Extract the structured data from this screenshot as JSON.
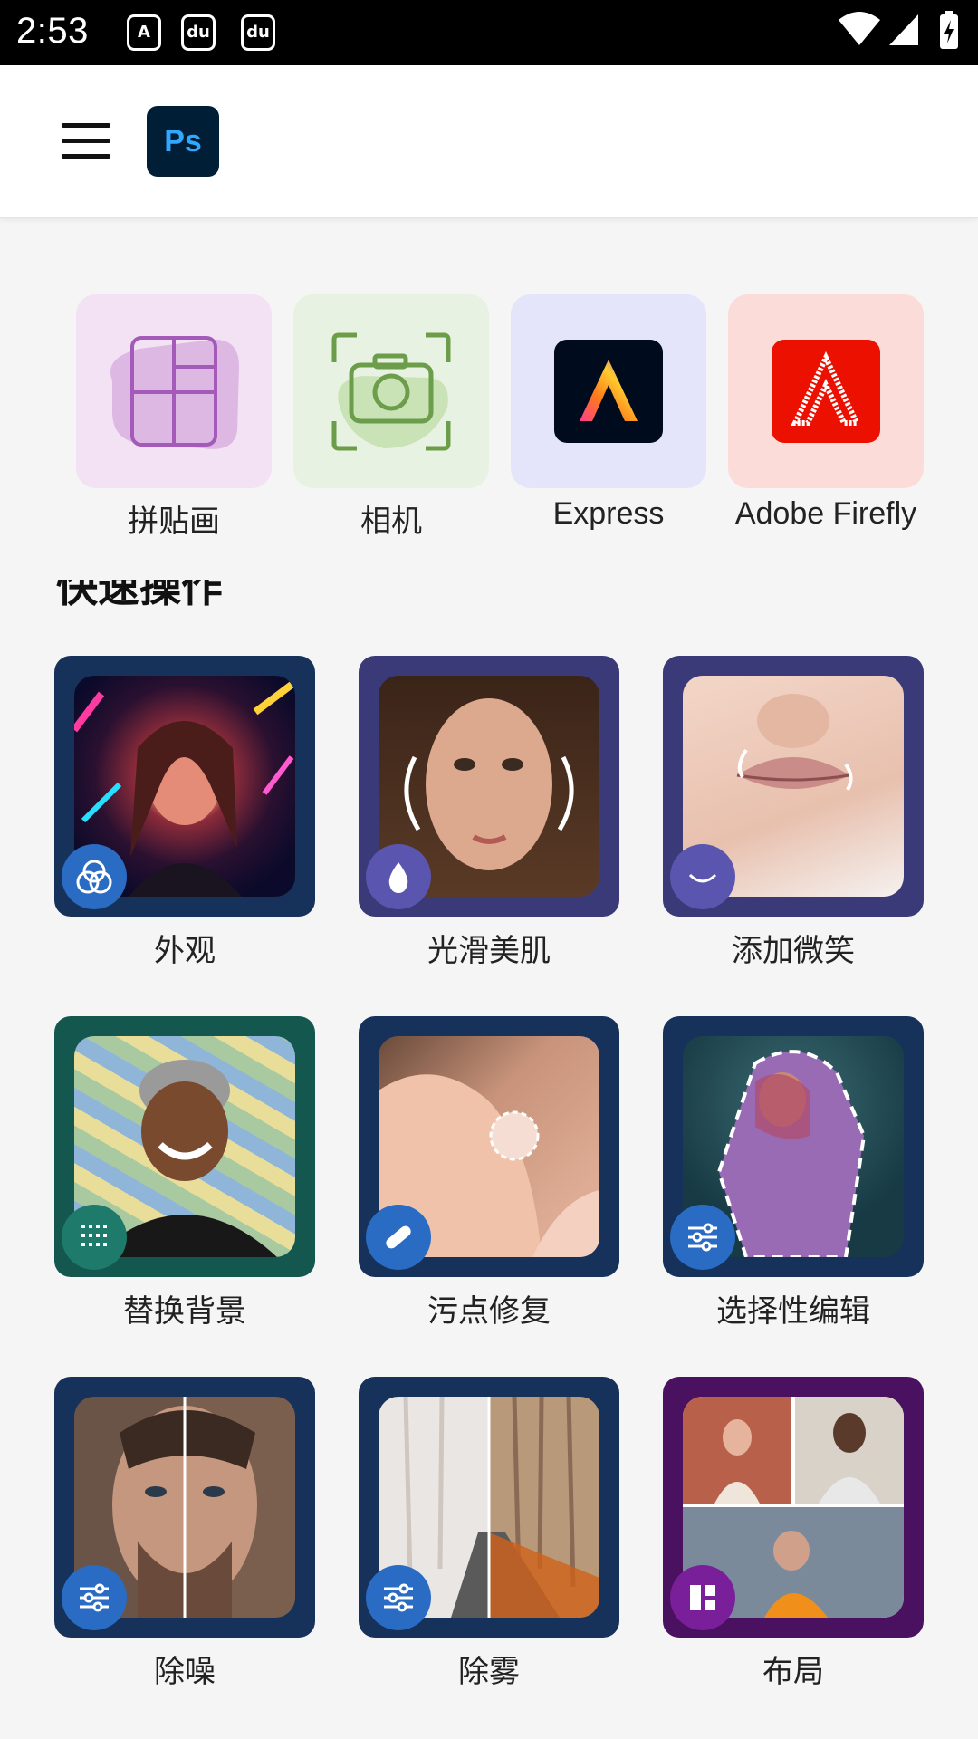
{
  "status_bar": {
    "time": "2:53",
    "notif_icons": [
      "a-icon",
      "baidu-icon",
      "baidu-icon"
    ],
    "right_icons": [
      "wifi-icon",
      "signal-icon",
      "battery-icon"
    ]
  },
  "app_bar": {
    "menu_icon": "hamburger-icon",
    "logo_text": "Ps"
  },
  "shortcuts": [
    {
      "label": "拼贴画",
      "icon": "collage-icon",
      "bg": "#f3e2f4"
    },
    {
      "label": "相机",
      "icon": "camera-icon",
      "bg": "#e8f2e2"
    },
    {
      "label": "Express",
      "icon": "adobe-express-icon",
      "bg": "#e4e4fb"
    },
    {
      "label": "Adobe Firefly",
      "icon": "adobe-firefly-icon",
      "bg": "#fcdcd8"
    }
  ],
  "section_title": "快速操作",
  "quick_actions": [
    {
      "label": "外观",
      "badge_icon": "looks-icon",
      "frame": "#16315a"
    },
    {
      "label": "光滑美肌",
      "badge_icon": "droplet-icon",
      "frame": "#3b3a78"
    },
    {
      "label": "添加微笑",
      "badge_icon": "smile-icon",
      "frame": "#3b3a78"
    },
    {
      "label": "替换背景",
      "badge_icon": "pattern-icon",
      "frame": "#13574e"
    },
    {
      "label": "污点修复",
      "badge_icon": "bandage-icon",
      "frame": "#16315a"
    },
    {
      "label": "选择性编辑",
      "badge_icon": "sliders-icon",
      "frame": "#16315a"
    },
    {
      "label": "除噪",
      "badge_icon": "sliders-icon",
      "frame": "#16315a"
    },
    {
      "label": "除雾",
      "badge_icon": "sliders-icon",
      "frame": "#16315a"
    },
    {
      "label": "布局",
      "badge_icon": "layout-icon",
      "frame": "#4b1161"
    }
  ]
}
